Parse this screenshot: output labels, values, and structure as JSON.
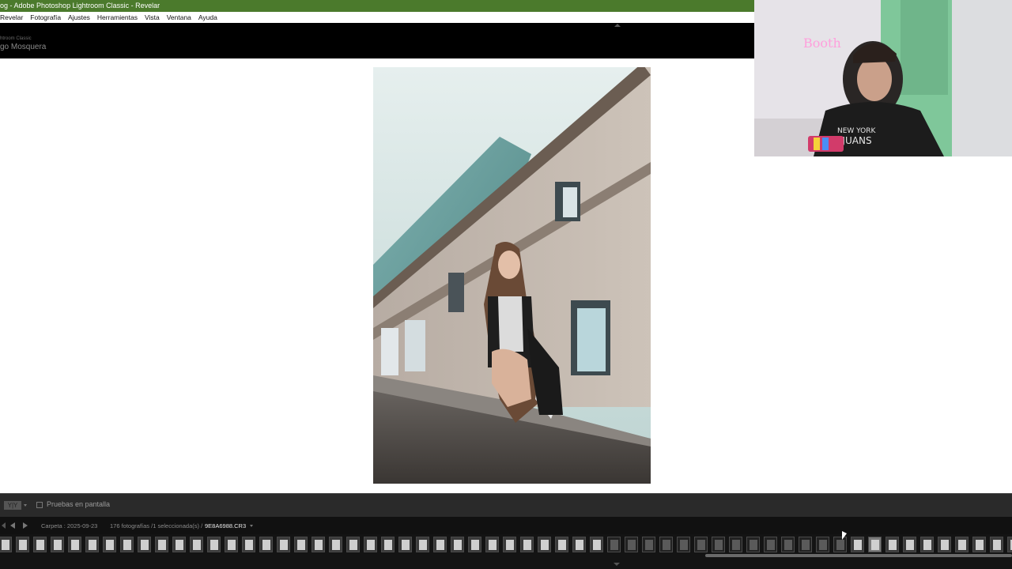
{
  "window": {
    "title": "og - Adobe Photoshop Lightroom Classic - Revelar"
  },
  "menu": [
    "Revelar",
    "Fotografía",
    "Ajustes",
    "Herramientas",
    "Vista",
    "Ventana",
    "Ayuda"
  ],
  "identity": {
    "app": "htroom Classic",
    "user": "go Mosquera"
  },
  "toolbar": {
    "view_mode": "Y|Y",
    "soft_proof_label": "Pruebas en pantalla",
    "soft_proof_checked": false
  },
  "navbar": {
    "folder": "Carpeta : 2025-09-23",
    "count": "176 fotografías /1 seleccionada(s) /",
    "filename": "9E8A6988.CR3"
  },
  "colors": {
    "title_bar": "#4b7a2c",
    "panel": "#2a2a2a",
    "filmstrip": "#141414"
  },
  "filmstrip": {
    "visible_thumbnails": 59,
    "selected_index": 50
  }
}
